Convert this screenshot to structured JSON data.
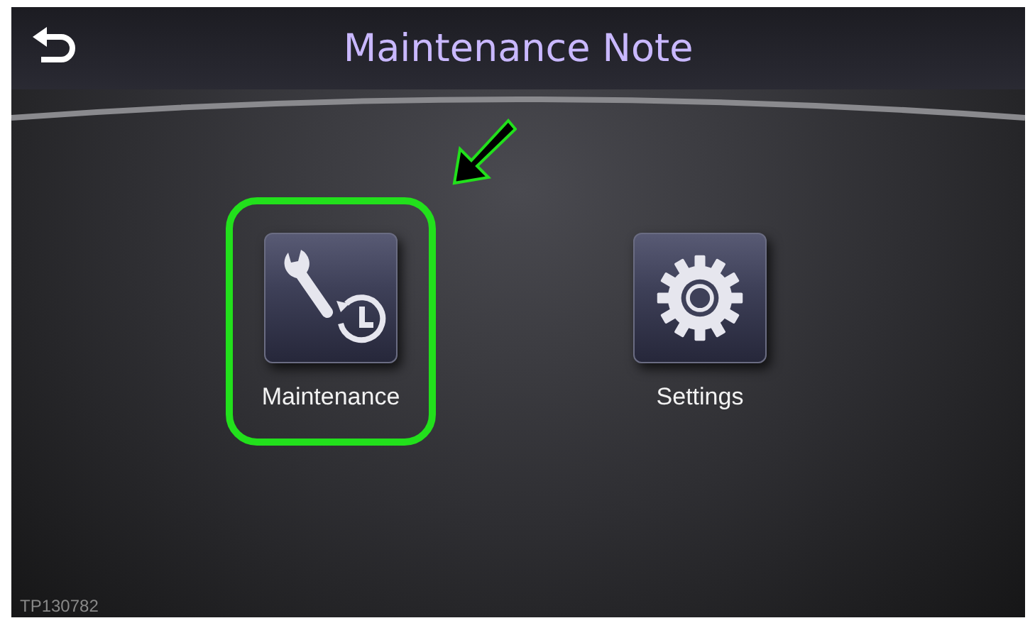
{
  "header": {
    "title": "Maintenance Note"
  },
  "menu_items": [
    {
      "kind": "maintenance",
      "label": "Maintenance",
      "highlighted": true
    },
    {
      "kind": "settings",
      "label": "Settings",
      "highlighted": false
    }
  ],
  "figure_code": "TP130782"
}
